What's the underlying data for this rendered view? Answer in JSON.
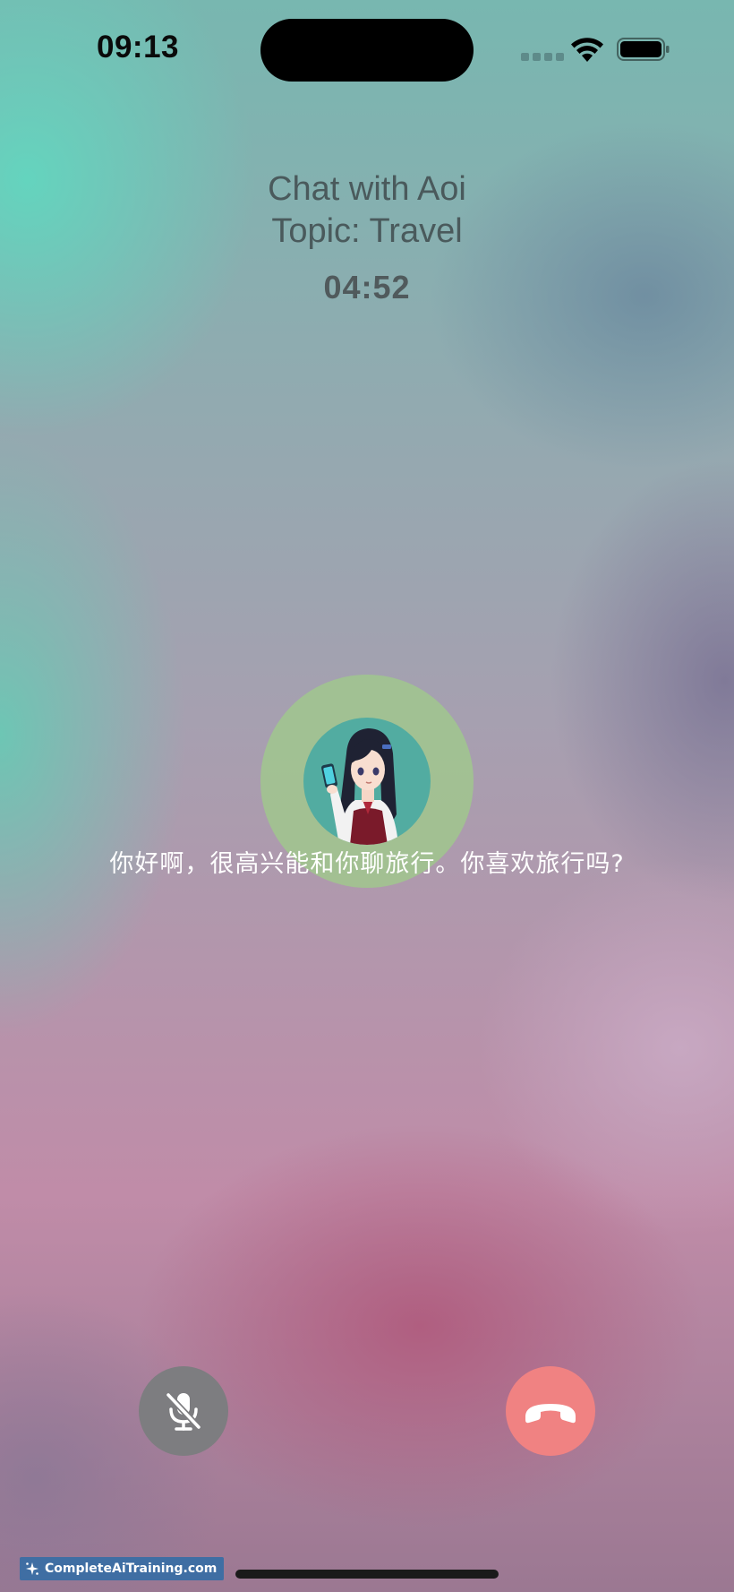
{
  "status_bar": {
    "time": "09:13",
    "wifi_icon": "wifi-icon",
    "battery_icon": "battery-icon"
  },
  "header": {
    "title": "Chat with Aoi",
    "topic": "Topic: Travel",
    "timer": "04:52"
  },
  "avatar": {
    "icon": "character-avatar"
  },
  "caption": "你好啊，很高兴能和你聊旅行。你喜欢旅行吗?",
  "controls": {
    "mute_icon": "microphone-slash-icon",
    "hangup_icon": "phone-hangup-icon",
    "mute_color": "#7d7d80",
    "hangup_color": "#f08282"
  },
  "watermark": {
    "text": "CompleteAiTraining.com"
  }
}
